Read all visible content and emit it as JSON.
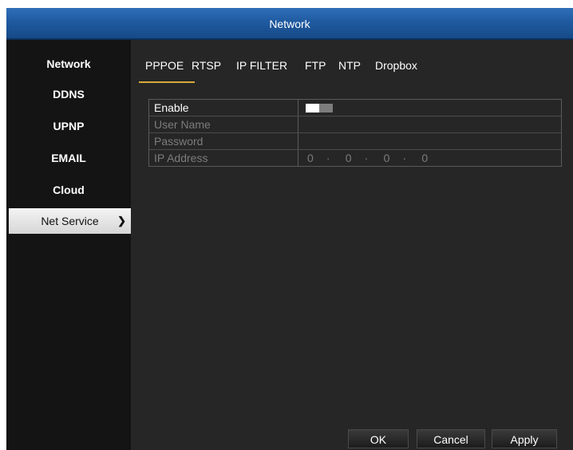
{
  "window": {
    "title": "Network"
  },
  "sidebar": {
    "items": [
      {
        "label": "Network"
      },
      {
        "label": "DDNS"
      },
      {
        "label": "UPNP"
      },
      {
        "label": "EMAIL"
      },
      {
        "label": "Cloud"
      },
      {
        "label": "Net Service",
        "active": true
      }
    ]
  },
  "tabs": [
    {
      "label": "PPPOE",
      "active": true
    },
    {
      "label": "RTSP"
    },
    {
      "label": "IP FILTER"
    },
    {
      "label": "FTP"
    },
    {
      "label": "NTP"
    },
    {
      "label": "Dropbox"
    }
  ],
  "form": {
    "rows": [
      {
        "label": "Enable",
        "enabled": true
      },
      {
        "label": "User Name",
        "value": ""
      },
      {
        "label": "Password",
        "value": ""
      },
      {
        "label": "IP Address",
        "octets": [
          "0",
          "0",
          "0",
          "0"
        ],
        "dot": "·"
      }
    ],
    "enable_toggle": "off"
  },
  "buttons": {
    "ok": "OK",
    "cancel": "Cancel",
    "apply": "Apply"
  },
  "colors": {
    "titlebar": "#1f5aa0",
    "tab_underline": "#d6a93b",
    "background": "#262626",
    "sidebar": "#141414"
  }
}
